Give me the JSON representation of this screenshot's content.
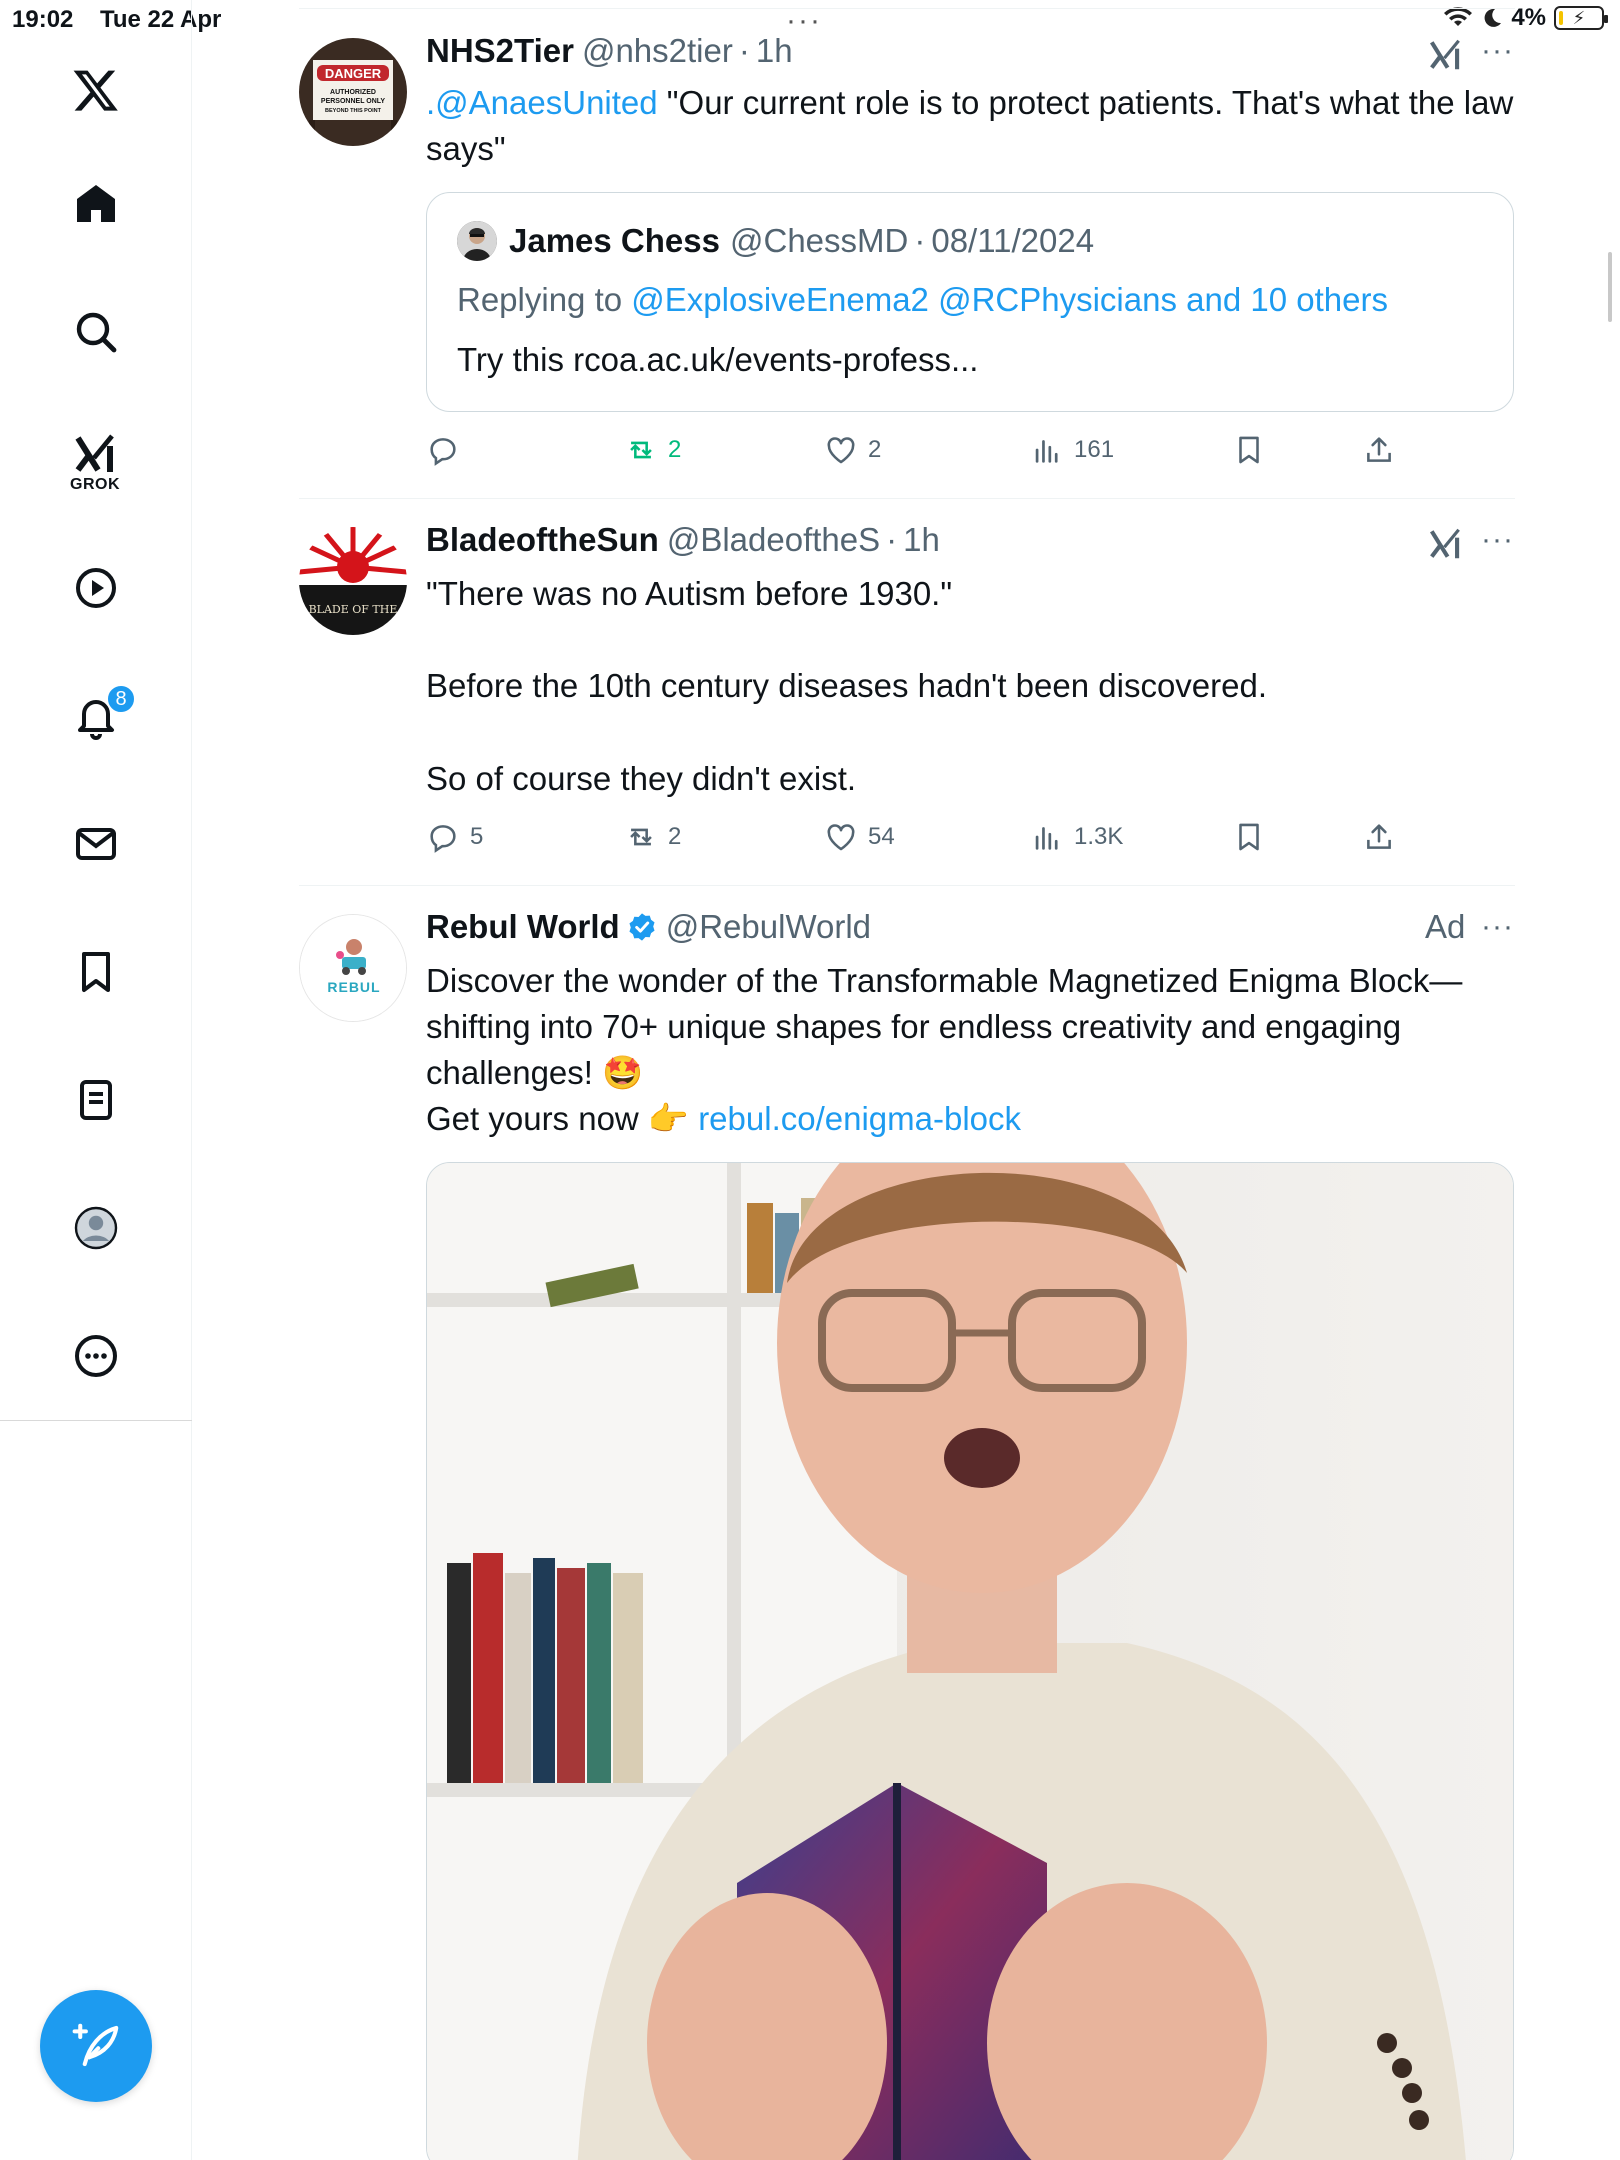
{
  "status_bar": {
    "time": "19:02",
    "date": "Tue 22 Apr",
    "battery": "4%",
    "battery_level": 0.04
  },
  "sidebar": {
    "logo": "x-logo-icon",
    "items": [
      {
        "icon": "home-icon"
      },
      {
        "icon": "search-icon"
      },
      {
        "icon": "grok-icon",
        "label": "GROK"
      },
      {
        "icon": "video-icon"
      },
      {
        "icon": "notifications-icon",
        "badge": "8"
      },
      {
        "icon": "messages-icon"
      },
      {
        "icon": "bookmarks-icon"
      },
      {
        "icon": "lists-icon"
      },
      {
        "icon": "profile-icon"
      },
      {
        "icon": "more-icon"
      }
    ],
    "compose_icon": "compose-icon"
  },
  "feed": [
    {
      "name": "NHS2Tier",
      "handle": "@nhs2tier",
      "ago": "1h",
      "avatar_sign": {
        "title": "DANGER",
        "line1": "AUTHORIZED",
        "line2": "PERSONNEL ONLY",
        "line3": "BEYOND THIS POINT"
      },
      "text_mention": ".@AnaesUnited",
      "text_rest": " \"Our current role is to protect patients. That's what the law says\"",
      "quote": {
        "name": "James  Chess",
        "handle": "@ChessMD",
        "date": "08/11/2024",
        "replying_prefix": "Replying to ",
        "replying_to": "@ExplosiveEnema2 @RCPhysicians and 10 others",
        "text": "Try this rcoa.ac.uk/events-profess..."
      },
      "replies": "",
      "reposts": "2",
      "likes": "2",
      "views": "161"
    },
    {
      "name": "BladeoftheSun",
      "handle": "@BladeoftheS",
      "ago": "1h",
      "avatar_text": "BLADE OF THE",
      "line1": "\"There was no Autism before 1930.\"",
      "line2": "Before the 10th century diseases hadn't been discovered.",
      "line3": "So of course they didn't exist.",
      "replies": "5",
      "reposts": "2",
      "likes": "54",
      "views": "1.3K"
    },
    {
      "name": "Rebul World",
      "handle": "@RebulWorld",
      "ad_label": "Ad",
      "avatar_text": "REBUL",
      "text": "Discover the wonder of the Transformable Magnetized Enigma Block—shifting into 70+ unique shapes for endless creativity and engaging challenges! 🤩",
      "cta_prefix": "Get yours now 👉 ",
      "cta_link": "rebul.co/enigma-block"
    }
  ],
  "separator": "·",
  "more_dots": "···"
}
